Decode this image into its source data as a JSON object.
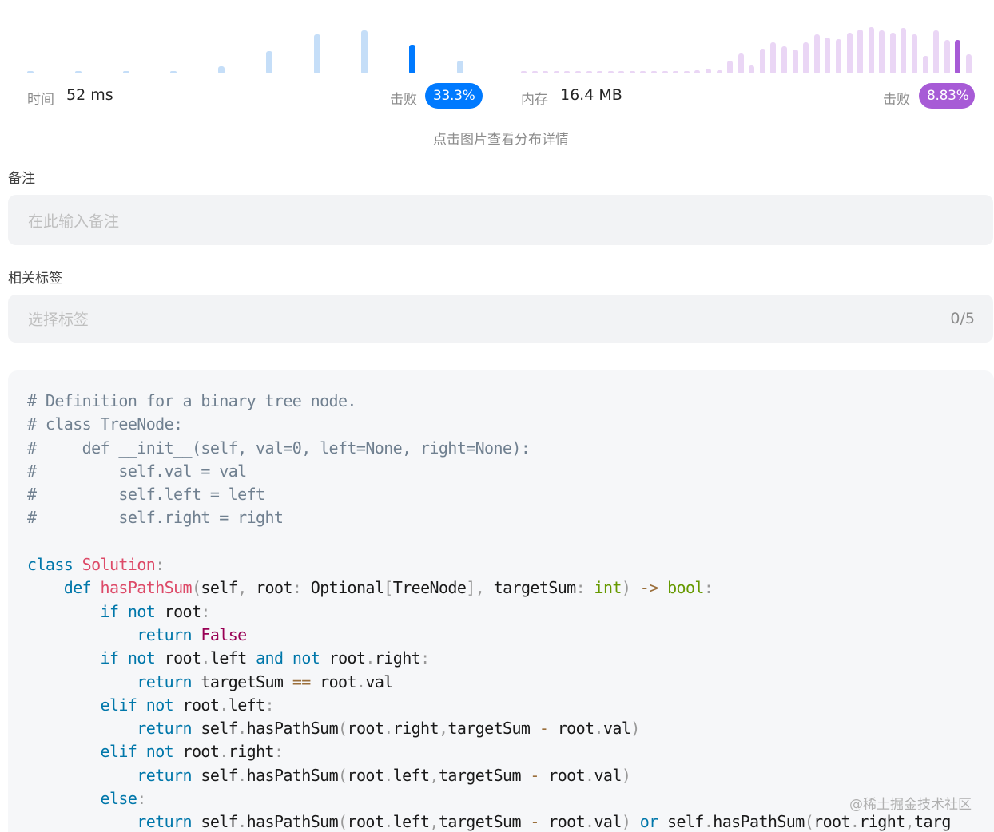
{
  "runtime": {
    "label": "时间",
    "value": "52 ms",
    "beat_label": "击败",
    "beat_percent": "33.3%",
    "distribution_bars": [
      0.04,
      0.04,
      0.04,
      0.04,
      0.12,
      0.38,
      0.66,
      0.72,
      0.48,
      0.21
    ],
    "highlight_index": 8
  },
  "memory": {
    "label": "内存",
    "value": "16.4 MB",
    "beat_label": "击败",
    "beat_percent": "8.83%",
    "distribution_bars": [
      0.04,
      0.04,
      0.04,
      0.04,
      0.04,
      0.04,
      0.04,
      0.04,
      0.04,
      0.04,
      0.04,
      0.04,
      0.04,
      0.04,
      0.04,
      0.04,
      0.06,
      0.08,
      0.06,
      0.22,
      0.34,
      0.14,
      0.42,
      0.52,
      0.46,
      0.4,
      0.52,
      0.66,
      0.6,
      0.58,
      0.68,
      0.74,
      0.78,
      0.72,
      0.68,
      0.76,
      0.66,
      0.3,
      0.72,
      0.56,
      0.56,
      0.32
    ],
    "highlight_index": 40
  },
  "hint": "点击图片查看分布详情",
  "notes": {
    "label": "备注",
    "placeholder": "在此输入备注"
  },
  "tags": {
    "label": "相关标签",
    "placeholder": "选择标签",
    "counter": "0/5"
  },
  "code_lines": [
    [
      [
        "c",
        "# Definition for a binary tree node."
      ]
    ],
    [
      [
        "c",
        "# class TreeNode:"
      ]
    ],
    [
      [
        "c",
        "#     def __init__(self, val=0, left=None, right=None):"
      ]
    ],
    [
      [
        "c",
        "#         self.val = val"
      ]
    ],
    [
      [
        "c",
        "#         self.left = left"
      ]
    ],
    [
      [
        "c",
        "#         self.right = right"
      ]
    ],
    [],
    [
      [
        "k",
        "class"
      ],
      [
        "",
        " "
      ],
      [
        "n",
        "Solution"
      ],
      [
        "p",
        ":"
      ]
    ],
    [
      [
        "",
        "    "
      ],
      [
        "k",
        "def"
      ],
      [
        "",
        " "
      ],
      [
        "n",
        "hasPathSum"
      ],
      [
        "p",
        "("
      ],
      [
        "",
        "self"
      ],
      [
        "p",
        ","
      ],
      [
        "",
        " root"
      ],
      [
        "p",
        ":"
      ],
      [
        "",
        " Optional"
      ],
      [
        "p",
        "["
      ],
      [
        "",
        "TreeNode"
      ],
      [
        "p",
        "]"
      ],
      [
        "p",
        ","
      ],
      [
        "",
        " targetSum"
      ],
      [
        "p",
        ":"
      ],
      [
        "",
        " "
      ],
      [
        "t",
        "int"
      ],
      [
        "p",
        ")"
      ],
      [
        "",
        " "
      ],
      [
        "o",
        "->"
      ],
      [
        "",
        " "
      ],
      [
        "t",
        "bool"
      ],
      [
        "p",
        ":"
      ]
    ],
    [
      [
        "",
        "        "
      ],
      [
        "k",
        "if"
      ],
      [
        "",
        " "
      ],
      [
        "k",
        "not"
      ],
      [
        "",
        " root"
      ],
      [
        "p",
        ":"
      ]
    ],
    [
      [
        "",
        "            "
      ],
      [
        "k",
        "return"
      ],
      [
        "",
        " "
      ],
      [
        "b",
        "False"
      ]
    ],
    [
      [
        "",
        "        "
      ],
      [
        "k",
        "if"
      ],
      [
        "",
        " "
      ],
      [
        "k",
        "not"
      ],
      [
        "",
        " root"
      ],
      [
        "p",
        "."
      ],
      [
        "",
        "left "
      ],
      [
        "k",
        "and"
      ],
      [
        "",
        " "
      ],
      [
        "k",
        "not"
      ],
      [
        "",
        " root"
      ],
      [
        "p",
        "."
      ],
      [
        "",
        "right"
      ],
      [
        "p",
        ":"
      ]
    ],
    [
      [
        "",
        "            "
      ],
      [
        "k",
        "return"
      ],
      [
        "",
        " targetSum "
      ],
      [
        "o",
        "=="
      ],
      [
        "",
        " root"
      ],
      [
        "p",
        "."
      ],
      [
        "",
        "val"
      ]
    ],
    [
      [
        "",
        "        "
      ],
      [
        "k",
        "elif"
      ],
      [
        "",
        " "
      ],
      [
        "k",
        "not"
      ],
      [
        "",
        " root"
      ],
      [
        "p",
        "."
      ],
      [
        "",
        "left"
      ],
      [
        "p",
        ":"
      ]
    ],
    [
      [
        "",
        "            "
      ],
      [
        "k",
        "return"
      ],
      [
        "",
        " self"
      ],
      [
        "p",
        "."
      ],
      [
        "",
        "hasPathSum"
      ],
      [
        "p",
        "("
      ],
      [
        "",
        "root"
      ],
      [
        "p",
        "."
      ],
      [
        "",
        "right"
      ],
      [
        "p",
        ","
      ],
      [
        "",
        "targetSum "
      ],
      [
        "o",
        "-"
      ],
      [
        "",
        " root"
      ],
      [
        "p",
        "."
      ],
      [
        "",
        "val"
      ],
      [
        "p",
        ")"
      ]
    ],
    [
      [
        "",
        "        "
      ],
      [
        "k",
        "elif"
      ],
      [
        "",
        " "
      ],
      [
        "k",
        "not"
      ],
      [
        "",
        " root"
      ],
      [
        "p",
        "."
      ],
      [
        "",
        "right"
      ],
      [
        "p",
        ":"
      ]
    ],
    [
      [
        "",
        "            "
      ],
      [
        "k",
        "return"
      ],
      [
        "",
        " self"
      ],
      [
        "p",
        "."
      ],
      [
        "",
        "hasPathSum"
      ],
      [
        "p",
        "("
      ],
      [
        "",
        "root"
      ],
      [
        "p",
        "."
      ],
      [
        "",
        "left"
      ],
      [
        "p",
        ","
      ],
      [
        "",
        "targetSum "
      ],
      [
        "o",
        "-"
      ],
      [
        "",
        " root"
      ],
      [
        "p",
        "."
      ],
      [
        "",
        "val"
      ],
      [
        "p",
        ")"
      ]
    ],
    [
      [
        "",
        "        "
      ],
      [
        "k",
        "else"
      ],
      [
        "p",
        ":"
      ]
    ],
    [
      [
        "",
        "            "
      ],
      [
        "k",
        "return"
      ],
      [
        "",
        " self"
      ],
      [
        "p",
        "."
      ],
      [
        "",
        "hasPathSum"
      ],
      [
        "p",
        "("
      ],
      [
        "",
        "root"
      ],
      [
        "p",
        "."
      ],
      [
        "",
        "left"
      ],
      [
        "p",
        ","
      ],
      [
        "",
        "targetSum "
      ],
      [
        "o",
        "-"
      ],
      [
        "",
        " root"
      ],
      [
        "p",
        "."
      ],
      [
        "",
        "val"
      ],
      [
        "p",
        ")"
      ],
      [
        "",
        " "
      ],
      [
        "k",
        "or"
      ],
      [
        "",
        " self"
      ],
      [
        "p",
        "."
      ],
      [
        "",
        "hasPathSum"
      ],
      [
        "p",
        "("
      ],
      [
        "",
        "root"
      ],
      [
        "p",
        "."
      ],
      [
        "",
        "right"
      ],
      [
        "p",
        ","
      ],
      [
        "",
        "targ"
      ]
    ]
  ],
  "watermark": "@稀土掘金技术社区",
  "colors": {
    "runtime_bar": "#c5def8",
    "runtime_highlight": "#007aff",
    "memory_bar": "#ead6f5",
    "memory_highlight": "#a75bd6"
  }
}
